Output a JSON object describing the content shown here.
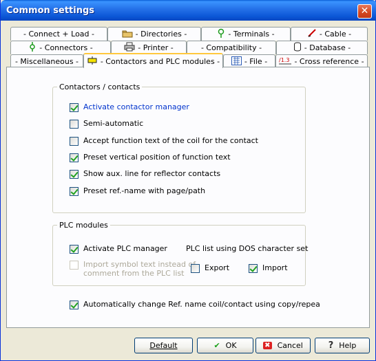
{
  "window": {
    "title": "Common settings",
    "close_glyph": "✕"
  },
  "tabs": {
    "row1": [
      {
        "label": "- Connect + Load -",
        "icon": ""
      },
      {
        "label": "- Directories -",
        "icon": "folder-icon"
      },
      {
        "label": "- Terminals -",
        "icon": "terminal-icon"
      },
      {
        "label": "- Cable -",
        "icon": "cable-icon"
      }
    ],
    "row2": [
      {
        "label": "- Connectors -",
        "icon": "connector-icon"
      },
      {
        "label": "- Printer -",
        "icon": "printer-icon"
      },
      {
        "label": "- Compatibility -",
        "icon": ""
      },
      {
        "label": "- Database -",
        "icon": "database-icon"
      }
    ],
    "row3": [
      {
        "label": "- Miscellaneous -",
        "icon": ""
      },
      {
        "label": "- Contactors and PLC modules -",
        "icon": "contactor-icon",
        "active": true
      },
      {
        "label": "- File -",
        "icon": "file-grid-icon"
      },
      {
        "label": "- Cross reference -",
        "icon": "cross-reference-icon"
      }
    ]
  },
  "contactors": {
    "legend": "Contactors / contacts",
    "items": [
      {
        "label": "Activate contactor manager",
        "checked": true
      },
      {
        "label": "Semi-automatic",
        "checked": false
      },
      {
        "label": "Accept function text of the coil for the contact",
        "checked": false
      },
      {
        "label": "Preset vertical position of function text",
        "checked": true
      },
      {
        "label": "Show aux. line for reflector contacts",
        "checked": true
      },
      {
        "label": "Preset ref.-name with page/path",
        "checked": true
      }
    ]
  },
  "plc": {
    "legend": "PLC modules",
    "activate_label": "Activate PLC manager",
    "activate_checked": true,
    "import_symbol_line1": "Import symbol text instead of",
    "import_symbol_line2": "comment from the PLC list",
    "dos_label": "PLC list using DOS character set",
    "export_label": "Export",
    "export_checked": false,
    "import_label": "Import",
    "import_checked": true
  },
  "auto_change": {
    "label": "Automatically change Ref. name coil/contact using copy/repea",
    "checked": true
  },
  "buttons": {
    "default_label": "Default",
    "ok_label": "OK",
    "ok_glyph": "✔",
    "cancel_label": "Cancel",
    "cancel_glyph": "✖",
    "help_label": "Help",
    "help_glyph": "?"
  }
}
